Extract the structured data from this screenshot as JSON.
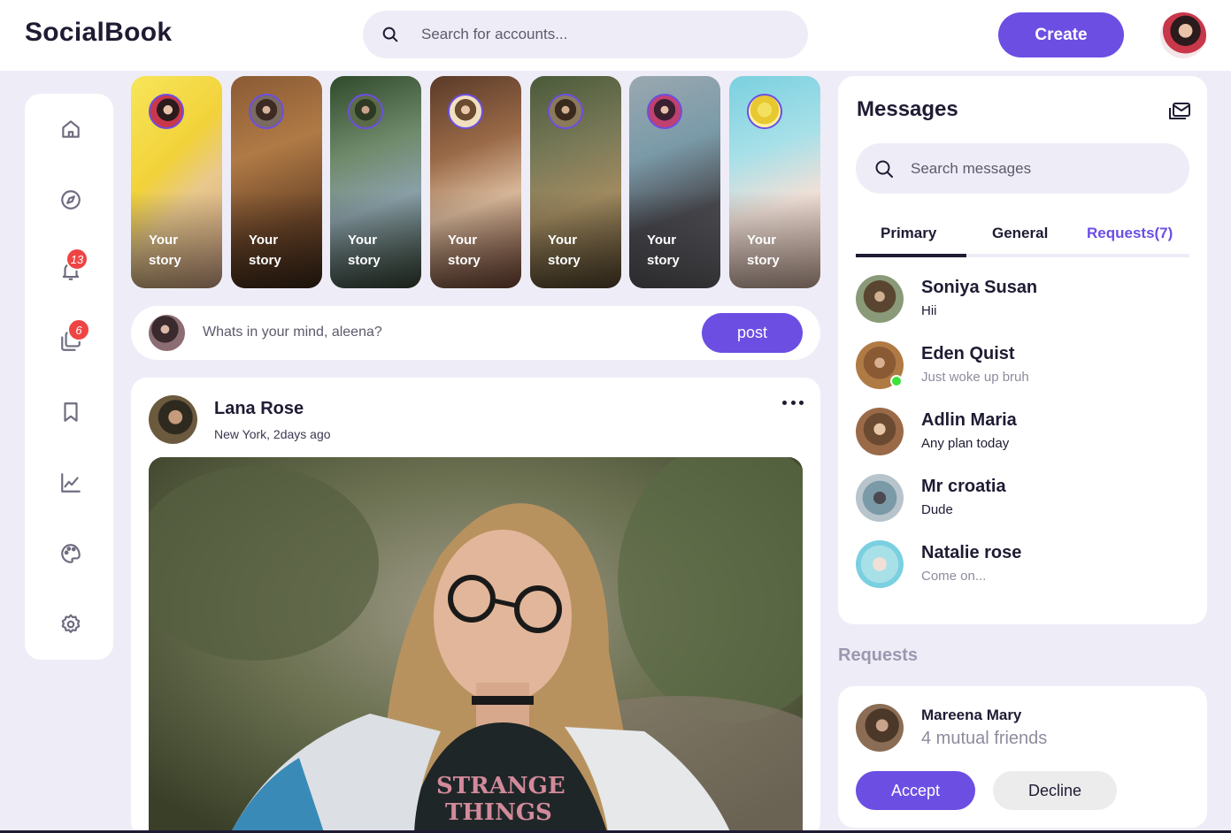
{
  "app": {
    "logo": "SocialBook"
  },
  "header": {
    "search_placeholder": "Search for accounts...",
    "create_label": "Create"
  },
  "sidebar": {
    "items": [
      {
        "icon": "home-icon"
      },
      {
        "icon": "explore-icon"
      },
      {
        "icon": "notifications-icon",
        "badge": "13"
      },
      {
        "icon": "messages-icon",
        "badge": "6"
      },
      {
        "icon": "bookmark-icon"
      },
      {
        "icon": "analytics-icon"
      },
      {
        "icon": "theme-icon"
      },
      {
        "icon": "settings-icon"
      }
    ]
  },
  "stories": [
    {
      "label_line1": "Your",
      "label_line2": "story"
    },
    {
      "label_line1": "Your",
      "label_line2": "story"
    },
    {
      "label_line1": "Your",
      "label_line2": "story"
    },
    {
      "label_line1": "Your",
      "label_line2": "story"
    },
    {
      "label_line1": "Your",
      "label_line2": "story"
    },
    {
      "label_line1": "Your",
      "label_line2": "story"
    },
    {
      "label_line1": "Your",
      "label_line2": "story"
    }
  ],
  "composer": {
    "placeholder": "Whats in your mind, aleena?",
    "post_label": "post"
  },
  "feed": {
    "author": "Lana Rose",
    "location": "New York, 2days ago"
  },
  "messages": {
    "title": "Messages",
    "search_placeholder": "Search messages",
    "tabs": [
      "Primary",
      "General",
      "Requests(7)"
    ],
    "items": [
      {
        "name": "Soniya Susan",
        "text": "Hii"
      },
      {
        "name": "Eden Quist",
        "text": "Just woke up bruh"
      },
      {
        "name": "Adlin Maria",
        "text": "Any plan today"
      },
      {
        "name": "Mr croatia",
        "text": "Dude"
      },
      {
        "name": "Natalie rose",
        "text": "Come on..."
      }
    ]
  },
  "requests": {
    "heading": "Requests",
    "name": "Mareena Mary",
    "mutual": "4 mutual friends",
    "accept_label": "Accept",
    "decline_label": "Decline"
  },
  "colors": {
    "accent": "#6c4ee3",
    "background": "#eeedf7",
    "badge": "#ef4444",
    "online": "#3be33b"
  }
}
